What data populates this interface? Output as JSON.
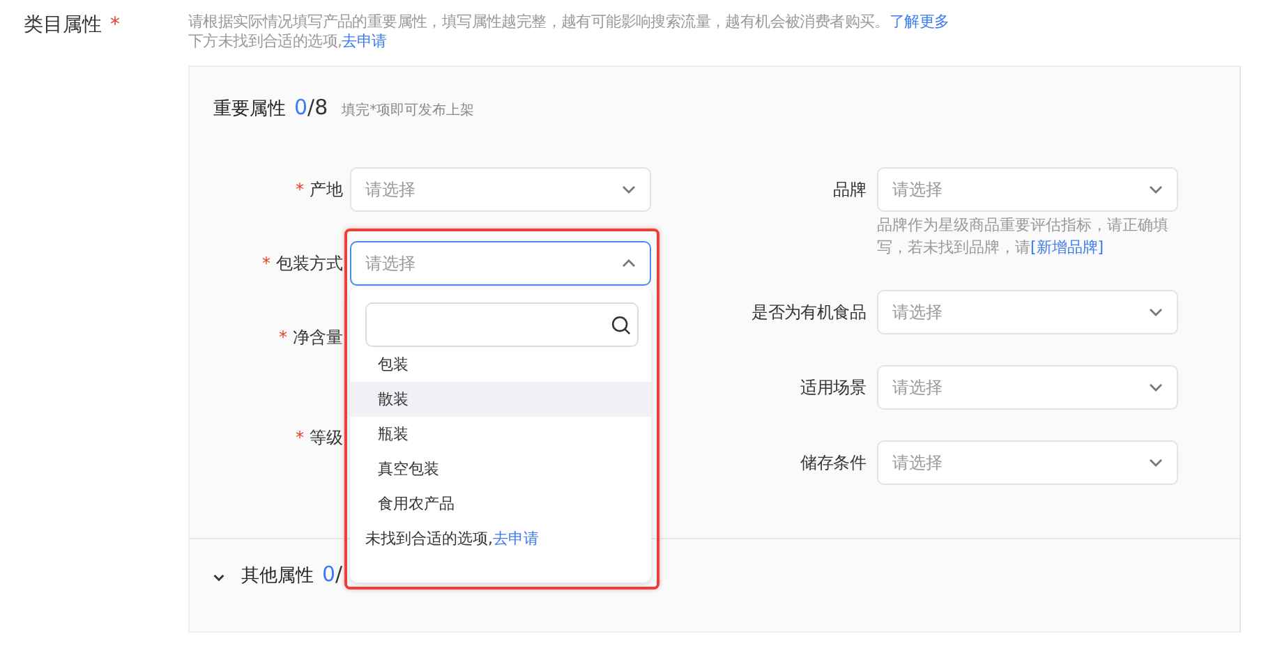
{
  "section": {
    "title": "类目属性",
    "required_mark": "*",
    "description": "请根据实际情况填写产品的重要属性，填写属性越完整，越有可能影响搜索流量，越有机会被消费者购买。",
    "learn_more_link": "了解更多",
    "apply_note": "下方未找到合适的选项,",
    "apply_link": "去申请"
  },
  "important": {
    "title": "重要属性",
    "count_done": "0",
    "count_total": "/8",
    "hint": "填完*项即可发布上架",
    "left_fields": [
      {
        "label": "产地",
        "required_mark": "*",
        "placeholder": "请选择",
        "open": false
      },
      {
        "label": "包装方式",
        "required_mark": "*",
        "placeholder": "请选择",
        "open": true,
        "highlight": true,
        "menu": {
          "options": [
            {
              "label": "包装",
              "selected": false
            },
            {
              "label": "散装",
              "selected": true
            },
            {
              "label": "瓶装",
              "selected": false
            },
            {
              "label": "真空包装",
              "selected": false
            },
            {
              "label": "食用农产品",
              "selected": false
            }
          ],
          "footer_text": "未找到合适的选项,",
          "footer_link": "去申请"
        }
      },
      {
        "label": "净含量",
        "required_mark": "*"
      },
      {
        "label": "等级",
        "required_mark": "*"
      }
    ],
    "right_fields": [
      {
        "label": "品牌",
        "placeholder": "请选择",
        "open": false,
        "help_text": "品牌作为星级商品重要评估指标，请正确填写，若未找到品牌，请",
        "help_link": "[新增品牌]"
      },
      {
        "label": "是否为有机食品",
        "placeholder": "请选择",
        "open": false
      },
      {
        "label": "适用场景",
        "placeholder": "请选择",
        "open": false
      },
      {
        "label": "储存条件",
        "placeholder": "请选择",
        "open": false
      }
    ]
  },
  "other": {
    "title": "其他属性",
    "count_done": "0",
    "count_total": "/",
    "expanded": false
  }
}
